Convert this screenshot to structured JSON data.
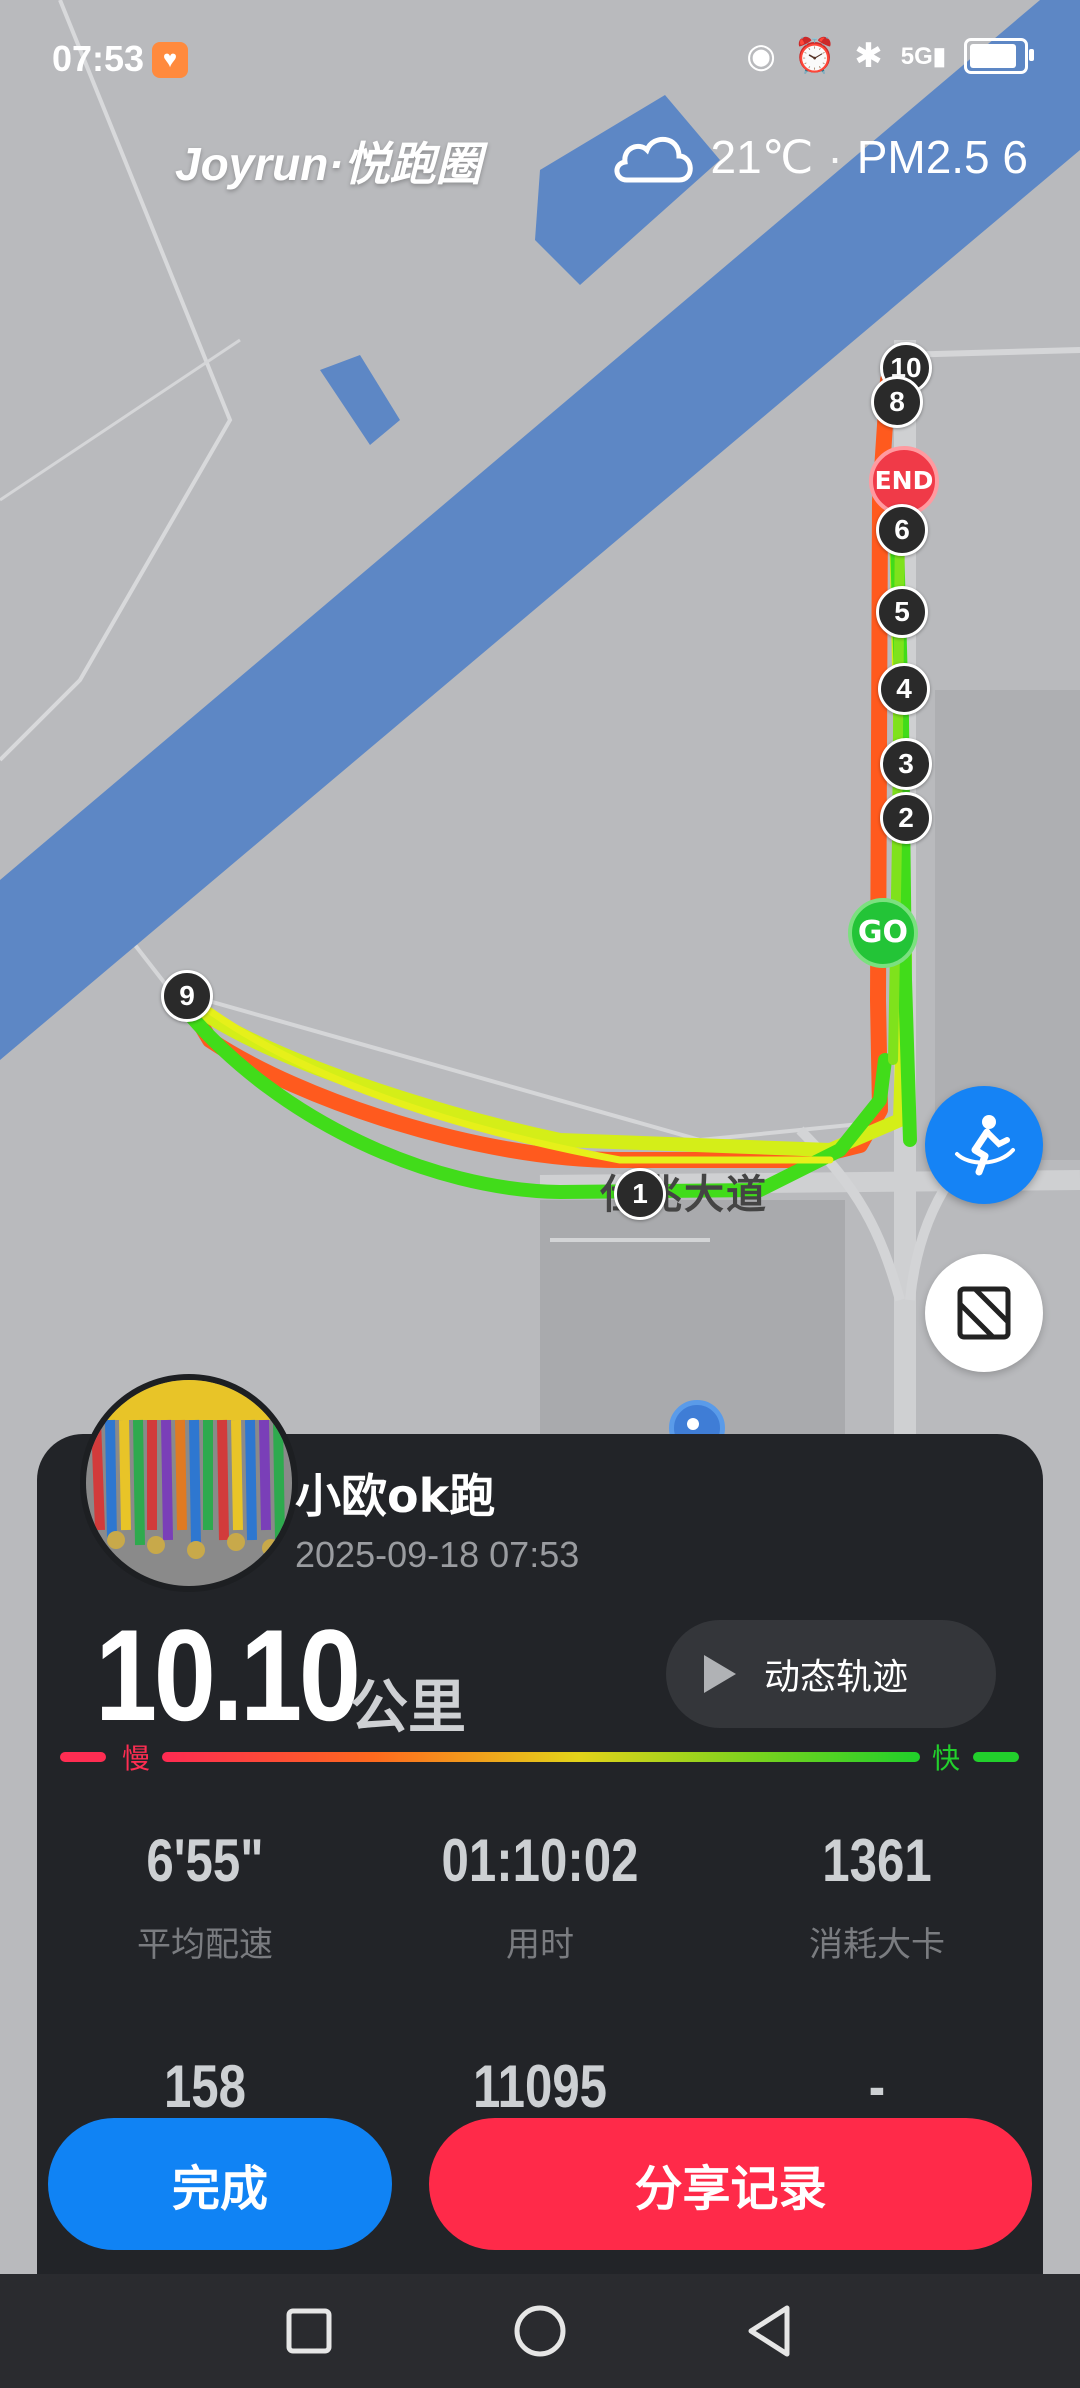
{
  "status_bar": {
    "time": "07:53",
    "badge_icon": "heart-icon",
    "icons": [
      "eye-icon",
      "alarm-icon",
      "bluetooth-icon",
      "signal-5g-icon",
      "battery-icon"
    ],
    "network": "5G"
  },
  "header": {
    "brand": "Joyrun·悦跑圈",
    "weather_icon": "cloud-icon",
    "temperature": "21℃",
    "separator": "·",
    "air_quality": "PM2.5 6"
  },
  "map": {
    "road_label": "仕兆大道",
    "go_label": "GO",
    "end_label": "END",
    "km_markers": [
      "1",
      "2",
      "3",
      "4",
      "5",
      "6",
      "8",
      "9",
      "10"
    ],
    "route_colors": {
      "fast": "#2fe018",
      "mid": "#c9ef1c",
      "slow": "#ff4a1e"
    }
  },
  "card": {
    "username": "小欧ok跑",
    "datetime": "2025-09-18 07:53",
    "distance": "10.10",
    "distance_unit": "公里",
    "replay_button": "动态轨迹",
    "pace_slow_label": "慢",
    "pace_fast_label": "快",
    "stats": [
      {
        "value": "6'55\"",
        "label": "平均配速"
      },
      {
        "value": "01:10:02",
        "label": "用时"
      },
      {
        "value": "1361",
        "label": "消耗大卡"
      },
      {
        "value": "158",
        "label": ""
      },
      {
        "value": "11095",
        "label": ""
      },
      {
        "value": "-",
        "label": ""
      }
    ]
  },
  "actions": {
    "done": "完成",
    "share": "分享记录"
  },
  "nav": [
    "recents-button",
    "home-button",
    "back-button"
  ]
}
